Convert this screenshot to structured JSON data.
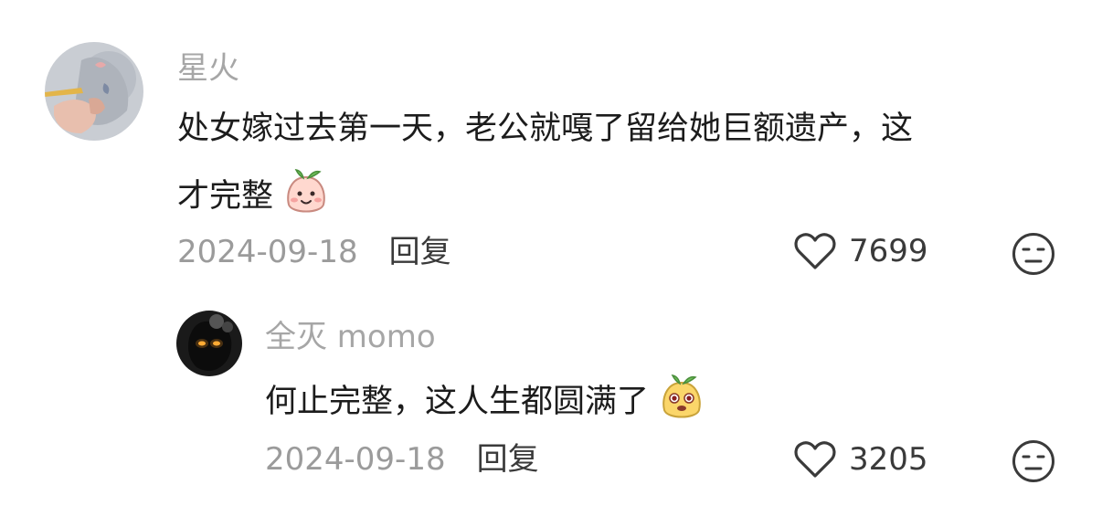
{
  "comments": [
    {
      "username": "星火",
      "text_line1": "处女嫁过去第一天，老公就嘎了留给她巨额遗产，这",
      "text_line2": "才完整",
      "emoji": "peach-smile-emoji",
      "date": "2024-09-18",
      "reply_label": "回复",
      "likes": "7699",
      "avatar": "hand-with-lace-sleeve-photo"
    },
    {
      "username": "全灭 momo",
      "text_line1": "何止完整，这人生都圆满了",
      "emoji": "yellow-blob-emoji",
      "date": "2024-09-18",
      "reply_label": "回复",
      "likes": "3205",
      "avatar": "dark-creature-glowing-eyes-photo"
    }
  ],
  "icons": {
    "like": "heart-outline-icon",
    "dislike": "meh-face-icon"
  },
  "colors": {
    "username": "#a6a6a6",
    "text": "#1c1c1c",
    "meta": "#9b9b9b",
    "icon": "#3a3a3a"
  }
}
